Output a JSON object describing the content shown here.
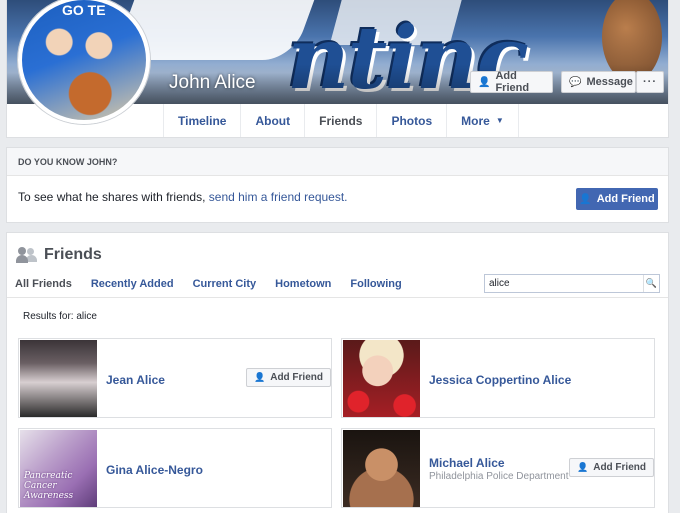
{
  "profile": {
    "name": "John Alice",
    "avatar_banner": "GO TE",
    "actions": {
      "add_friend": "Add Friend",
      "message": "Message",
      "more": "···"
    },
    "tabs": [
      {
        "label": "Timeline"
      },
      {
        "label": "About"
      },
      {
        "label": "Friends"
      },
      {
        "label": "Photos"
      },
      {
        "label": "More"
      }
    ]
  },
  "know": {
    "heading": "DO YOU KNOW JOHN?",
    "text_prefix": "To see what he shares with friends, ",
    "link": "send him a friend request.",
    "button": "Add Friend"
  },
  "friends": {
    "title": "Friends",
    "subtabs": [
      {
        "label": "All Friends"
      },
      {
        "label": "Recently Added"
      },
      {
        "label": "Current City"
      },
      {
        "label": "Hometown"
      },
      {
        "label": "Following"
      }
    ],
    "search": {
      "value": "alice"
    },
    "results_label": "Results for: alice",
    "list": [
      {
        "name": "Jean Alice",
        "subtitle": "",
        "button": "Add Friend"
      },
      {
        "name": "Jessica Coppertino Alice",
        "subtitle": "",
        "button": ""
      },
      {
        "name": "Gina Alice-Negro",
        "subtitle": "",
        "button": "",
        "photo_text": "Pancreatic Cancer Awareness"
      },
      {
        "name": "Michael Alice",
        "subtitle": "Philadelphia Police Department",
        "button": "Add Friend"
      }
    ]
  },
  "colors": {
    "link_blue": "#365899",
    "primary_button": "#4267b2",
    "page_bg": "#e9ebee"
  }
}
